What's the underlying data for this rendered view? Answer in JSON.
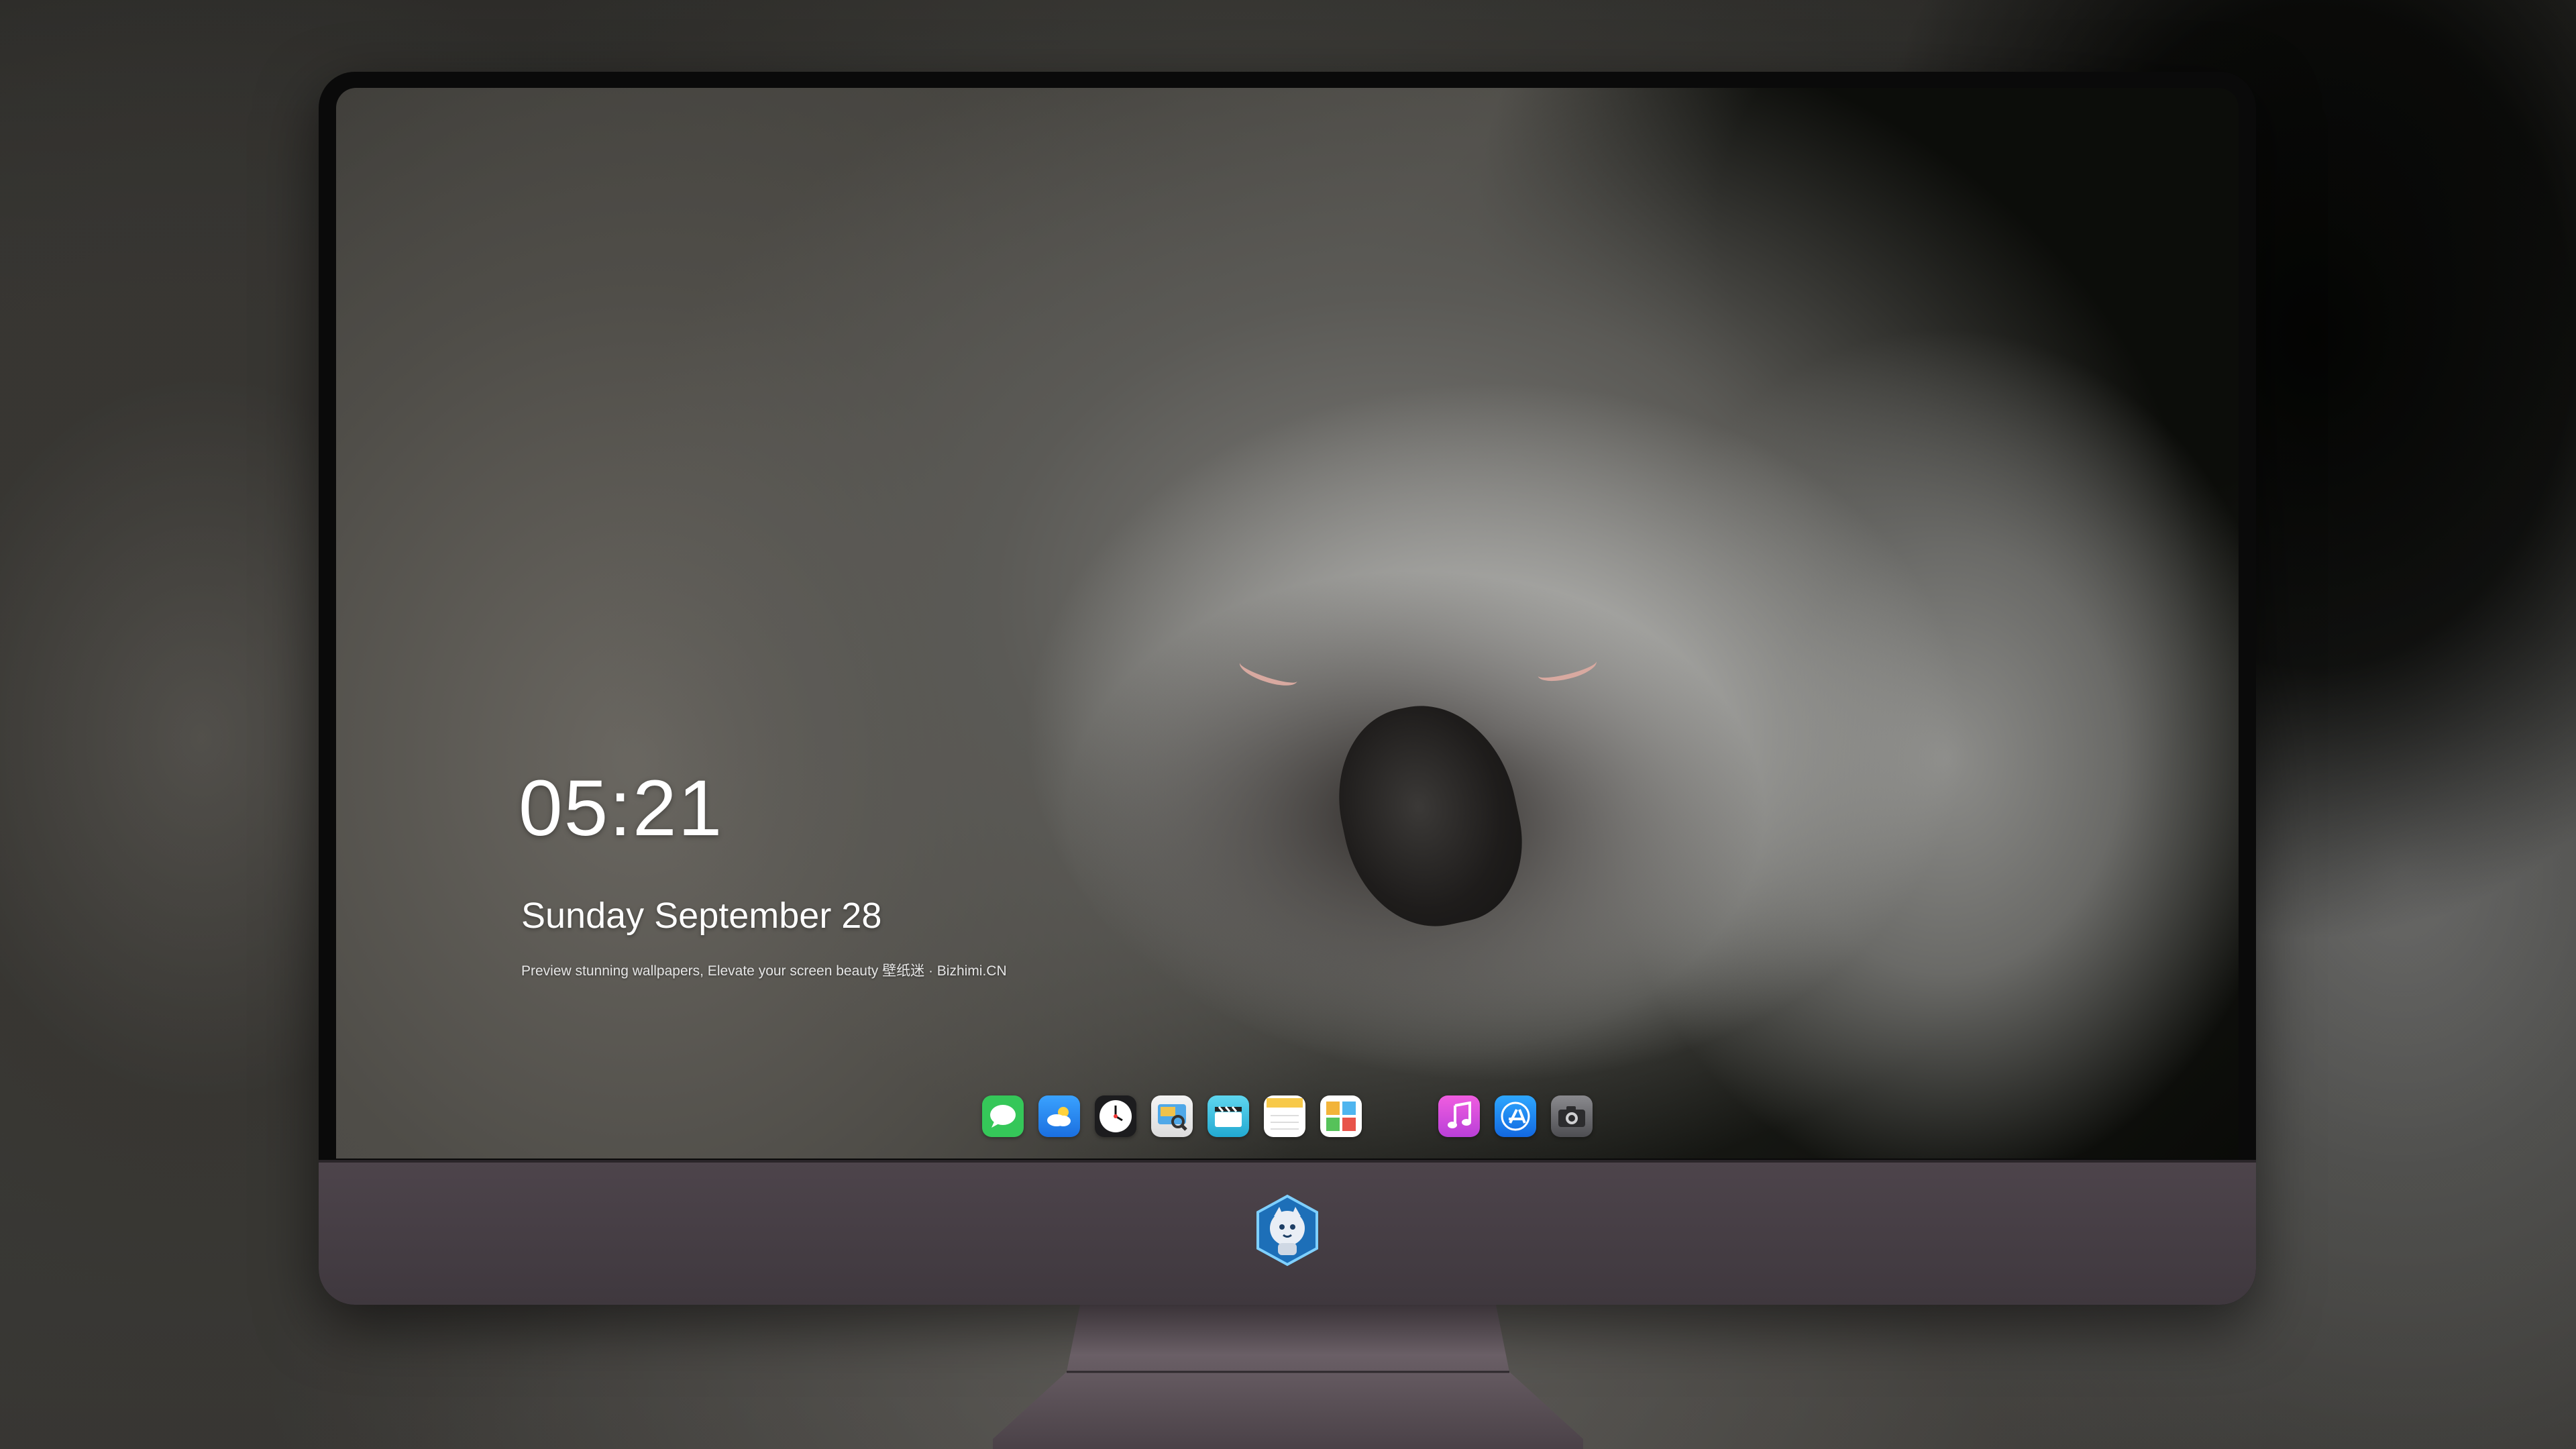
{
  "lockscreen": {
    "time": "05:21",
    "date": "Sunday September  28",
    "tagline": "Preview stunning wallpapers, Elevate your screen beauty  壁纸迷 · Bizhimi.CN"
  },
  "dock": {
    "apps": [
      {
        "icon": "messages-icon",
        "color": "#35c759"
      },
      {
        "icon": "weather-icon",
        "color": "#2f8df5"
      },
      {
        "icon": "clock-icon",
        "color": "#1c1c1e"
      },
      {
        "icon": "preview-icon",
        "color": "#e9b949"
      },
      {
        "icon": "video-editor-icon",
        "color": "#37c4e6"
      },
      {
        "icon": "notes-icon",
        "color": "#f7d14a"
      },
      {
        "icon": "photo-app-icon",
        "color": "#ffffff"
      },
      {
        "icon": "music-icon",
        "color": "#e34cd6"
      },
      {
        "icon": "app-store-icon",
        "color": "#1e8ff0"
      },
      {
        "icon": "camera-icon",
        "color": "#6b6b6f"
      }
    ]
  },
  "colors": {
    "bezel": "#0a0a0a",
    "chin": "#4a4248",
    "stand": "#5a5057"
  }
}
